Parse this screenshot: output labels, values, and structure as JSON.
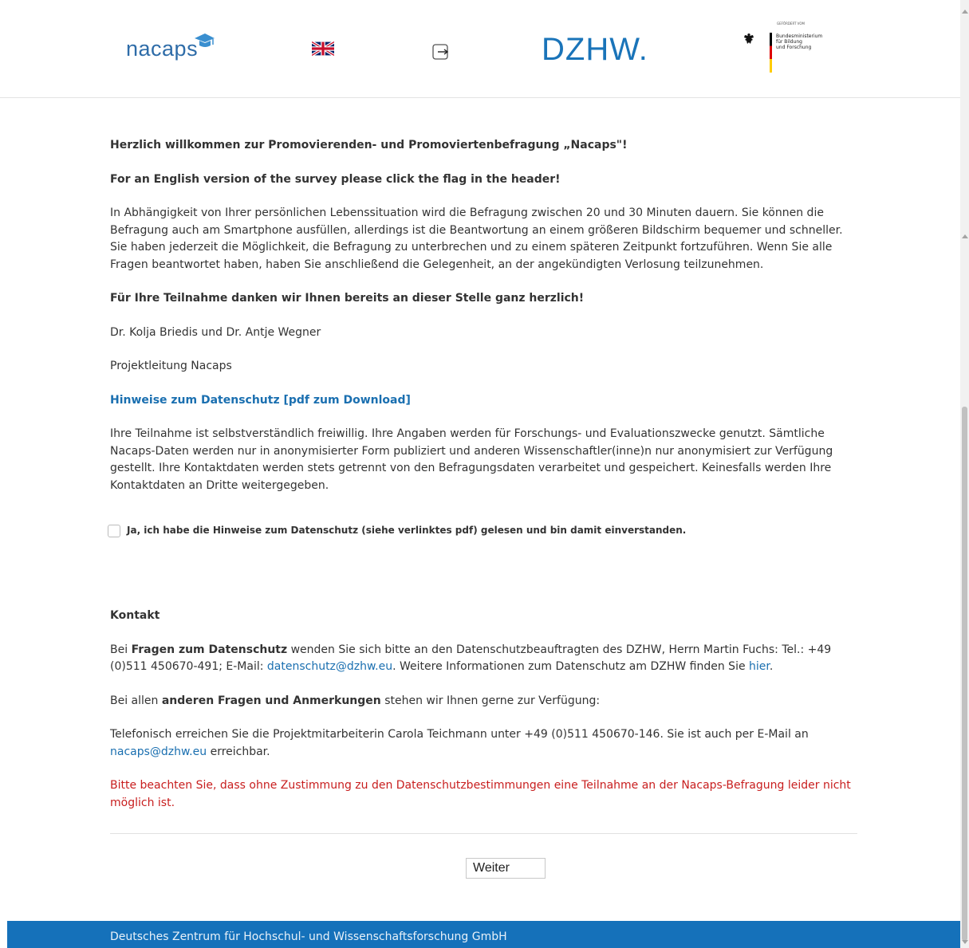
{
  "header": {
    "nacaps_logo": "nacaps",
    "dzhw_logo": "DZHW.",
    "bmbf": {
      "small": "GEFÖRDERT VOM",
      "line1": "Bundesministerium",
      "line2": "für Bildung",
      "line3": "und Forschung"
    },
    "icons": {
      "flag": "uk-flag-icon",
      "logout": "logout-icon"
    }
  },
  "main": {
    "welcome": "Herzlich willkommen zur Promovierenden- und Promoviertenbefragung „Nacaps\"!",
    "english": "For an English version of the survey please click the flag in the header!",
    "intro": "In Abhängigkeit von Ihrer persönlichen Lebenssituation wird die Befragung zwischen 20 und 30 Minuten dauern. Sie können die Befragung auch am Smartphone ausfüllen, allerdings ist die Beantwortung an einem größeren Bildschirm bequemer und schneller. Sie haben jederzeit die Möglichkeit, die Befragung zu unterbrechen und zu einem späteren Zeitpunkt fortzuführen. Wenn Sie alle Fragen beantwortet haben, haben Sie anschließend die Gelegenheit, an der angekündigten Verlosung teilzunehmen.",
    "thanks": "Für Ihre Teilnahme danken wir Ihnen bereits an dieser Stelle ganz herzlich!",
    "names": "Dr. Kolja Briedis und Dr. Antje Wegner",
    "role": "Projektleitung Nacaps",
    "privacy_link": "Hinweise zum Datenschutz [pdf zum Download]",
    "privacy_text": "Ihre Teilnahme ist selbstverständlich freiwillig. Ihre Angaben werden für Forschungs- und Evaluationszwecke genutzt. Sämtliche Nacaps-Daten werden nur in anonymisierter Form publiziert und anderen Wissenschaftler(inne)n nur anonymisiert zur Verfügung gestellt. Ihre Kontaktdaten werden stets getrennt von den Befragungsdaten verarbeitet und gespeichert. Keinesfalls werden Ihre Kontaktdaten an Dritte weitergegeben.",
    "consent_label": "Ja, ich habe die Hinweise zum Datenschutz (siehe verlinktes pdf) gelesen und bin damit einverstanden.",
    "consent_checked": false
  },
  "contact": {
    "heading": "Kontakt",
    "p1_a": "Bei ",
    "p1_bold": "Fragen zum Datenschutz",
    "p1_b": " wenden Sie sich bitte an den Datenschutzbeauftragten des DZHW, Herrn Martin Fuchs: Tel.: +49 (0)511 450670-491; E-Mail: ",
    "p1_email": "datenschutz@dzhw.eu",
    "p1_c": ". Weitere Informationen zum Datenschutz am DZHW finden Sie ",
    "p1_link": "hier",
    "p1_d": ".",
    "p2_a": "Bei allen ",
    "p2_bold": "anderen Fragen und Anmerkungen",
    "p2_b": " stehen wir Ihnen gerne zur Verfügung:",
    "p3_a": "Telefonisch erreichen Sie die Projektmitarbeiterin Carola Teichmann unter +49 (0)511 450670-146. Sie ist auch per E-Mail an ",
    "p3_email": "nacaps@dzhw.eu",
    "p3_b": " erreichbar.",
    "warning": "Bitte beachten Sie, dass ohne Zustimmung zu den Datenschutzbestimmungen eine Teilnahme an der Nacaps-Befragung leider nicht möglich ist."
  },
  "buttons": {
    "next": "Weiter"
  },
  "footer": {
    "text": "Deutsches Zentrum für Hochschul- und Wissenschaftsforschung GmbH"
  },
  "colors": {
    "accent": "#1571ba",
    "link": "#1a6fb0",
    "warning": "#c81e1e"
  }
}
